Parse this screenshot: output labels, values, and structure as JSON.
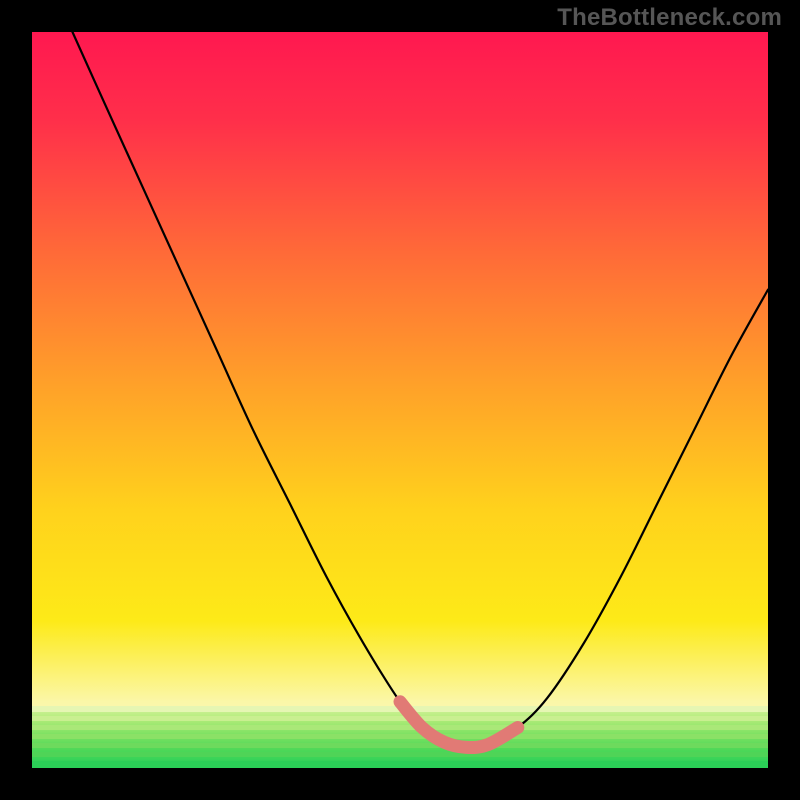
{
  "watermark": "TheBottleneck.com",
  "colors": {
    "frame_bg": "#000000",
    "curve": "#000000",
    "highlight": "#e17a75",
    "gradient_top": "#ff1850",
    "gradient_bottom": "#23cf59"
  },
  "chart_data": {
    "type": "line",
    "title": "",
    "xlabel": "",
    "ylabel": "",
    "xlim": [
      0,
      1
    ],
    "ylim": [
      0,
      1
    ],
    "series": [
      {
        "name": "curve",
        "x": [
          0.055,
          0.1,
          0.15,
          0.2,
          0.25,
          0.3,
          0.35,
          0.4,
          0.45,
          0.5,
          0.53,
          0.56,
          0.59,
          0.62,
          0.66,
          0.7,
          0.75,
          0.8,
          0.85,
          0.9,
          0.95,
          1.0
        ],
        "y": [
          1.0,
          0.9,
          0.79,
          0.68,
          0.57,
          0.46,
          0.36,
          0.26,
          0.17,
          0.09,
          0.055,
          0.035,
          0.028,
          0.032,
          0.055,
          0.095,
          0.17,
          0.26,
          0.36,
          0.46,
          0.56,
          0.65
        ]
      }
    ],
    "highlight_range_x": [
      0.5,
      0.67
    ],
    "band_y_range": [
      0.0,
      0.084
    ]
  }
}
